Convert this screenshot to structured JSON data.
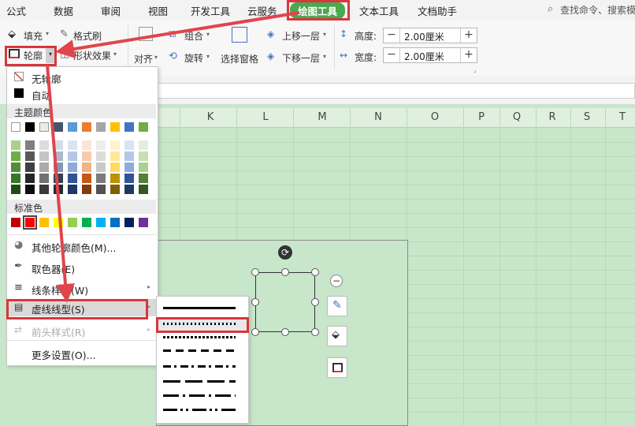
{
  "tabs": [
    "公式",
    "数据",
    "审阅",
    "视图",
    "开发工具",
    "云服务",
    "绘图工具",
    "文本工具",
    "文档助手"
  ],
  "search": {
    "text": "查找命令、搜索模"
  },
  "ribbon": {
    "fill": "填充",
    "format_painter": "格式刷",
    "outline": "轮廓",
    "shape_effect": "形状效果",
    "align": "对齐",
    "group": "组合",
    "rotate": "旋转",
    "selection_pane": "选择窗格",
    "bring_forward": "上移一层",
    "send_backward": "下移一层",
    "height_label": "高度:",
    "width_label": "宽度:",
    "height_value": "2.00厘米",
    "width_value": "2.00厘米"
  },
  "columns": [
    "K",
    "L",
    "M",
    "N",
    "O",
    "P",
    "Q",
    "R",
    "S",
    "T"
  ],
  "menu": {
    "no_outline": "无轮廓",
    "automatic": "自动",
    "theme_colors": "主题颜色",
    "standard_colors": "标准色",
    "more_colors": "其他轮廓颜色(M)...",
    "eyedropper": "取色器(E)",
    "line_style": "线条样式(W)",
    "dash_type": "虚线线型(S)",
    "arrow_style": "前头样式(R)",
    "more_settings": "更多设置(O)..."
  },
  "colors": {
    "accent": "#4aa84e",
    "highlight": "#d9363e",
    "theme_top": [
      "#ffffff",
      "#000000",
      "#eeece1",
      "#44546a",
      "#5b9bd5",
      "#ed7d31",
      "#a5a5a5",
      "#ffc000",
      "#4472c4",
      "#70ad47"
    ],
    "theme_grid": [
      [
        "#a9d18e",
        "#7f7f7f",
        "#dddddd",
        "#d6dce4",
        "#dae3f3",
        "#fbe5d6",
        "#ededed",
        "#fff2cc",
        "#dae3f3",
        "#e2efda"
      ],
      [
        "#70ad47",
        "#595959",
        "#c4c4c4",
        "#adb9ca",
        "#b4c7e7",
        "#f8cbad",
        "#dbdbdb",
        "#ffe699",
        "#b4c7e7",
        "#c5e0b4"
      ],
      [
        "#4e8f35",
        "#3f3f3f",
        "#aeaaaa",
        "#8497b0",
        "#8faadc",
        "#f4b183",
        "#c9c9c9",
        "#ffd966",
        "#8faadc",
        "#a9d18e"
      ],
      [
        "#38762a",
        "#262626",
        "#757171",
        "#333f50",
        "#2f5597",
        "#c55a11",
        "#7b7b7b",
        "#bf9000",
        "#2f5597",
        "#548235"
      ],
      [
        "#1f4d17",
        "#0d0d0d",
        "#3a3838",
        "#222a35",
        "#1f3864",
        "#843c0c",
        "#525252",
        "#7f6000",
        "#1f3864",
        "#375623"
      ]
    ],
    "standard": [
      "#c00000",
      "#ff0000",
      "#ffc000",
      "#ffff00",
      "#92d050",
      "#00b050",
      "#00b0f0",
      "#0070c0",
      "#002060",
      "#7030a0"
    ]
  }
}
